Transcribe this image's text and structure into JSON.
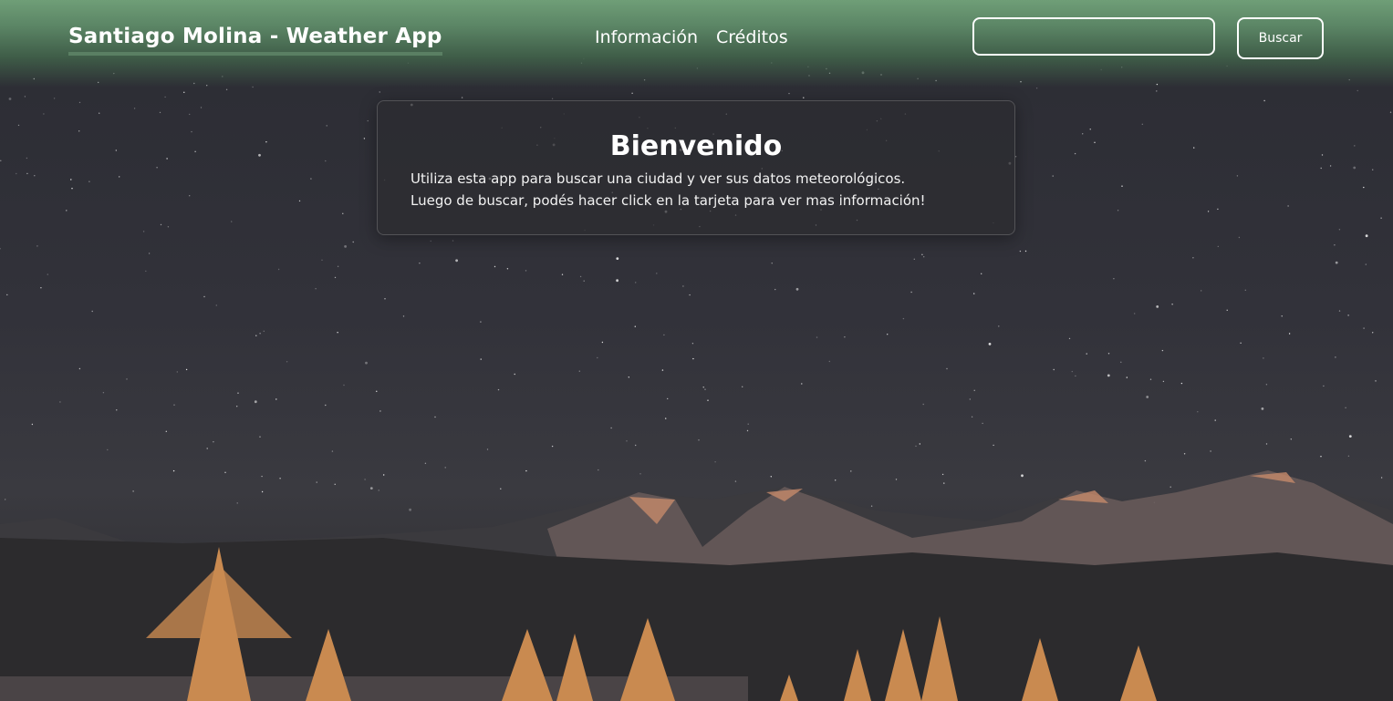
{
  "navbar": {
    "brand": "Santiago Molina - Weather App",
    "links": [
      {
        "label": "Información"
      },
      {
        "label": "Créditos"
      }
    ],
    "search": {
      "value": "",
      "placeholder": ""
    },
    "search_button_label": "Buscar"
  },
  "welcome": {
    "title": "Bienvenido",
    "line1": "Utiliza esta app para buscar una ciudad y ver sus datos meteorológicos.",
    "line2": "Luego de buscar, podés hacer click en la tarjeta para ver mas información!"
  },
  "colors": {
    "navbar_green": "#6f9e77",
    "brand_underline": "#5a7f63",
    "sky": "#2f2f36",
    "tree_highlight": "#e0a060"
  }
}
